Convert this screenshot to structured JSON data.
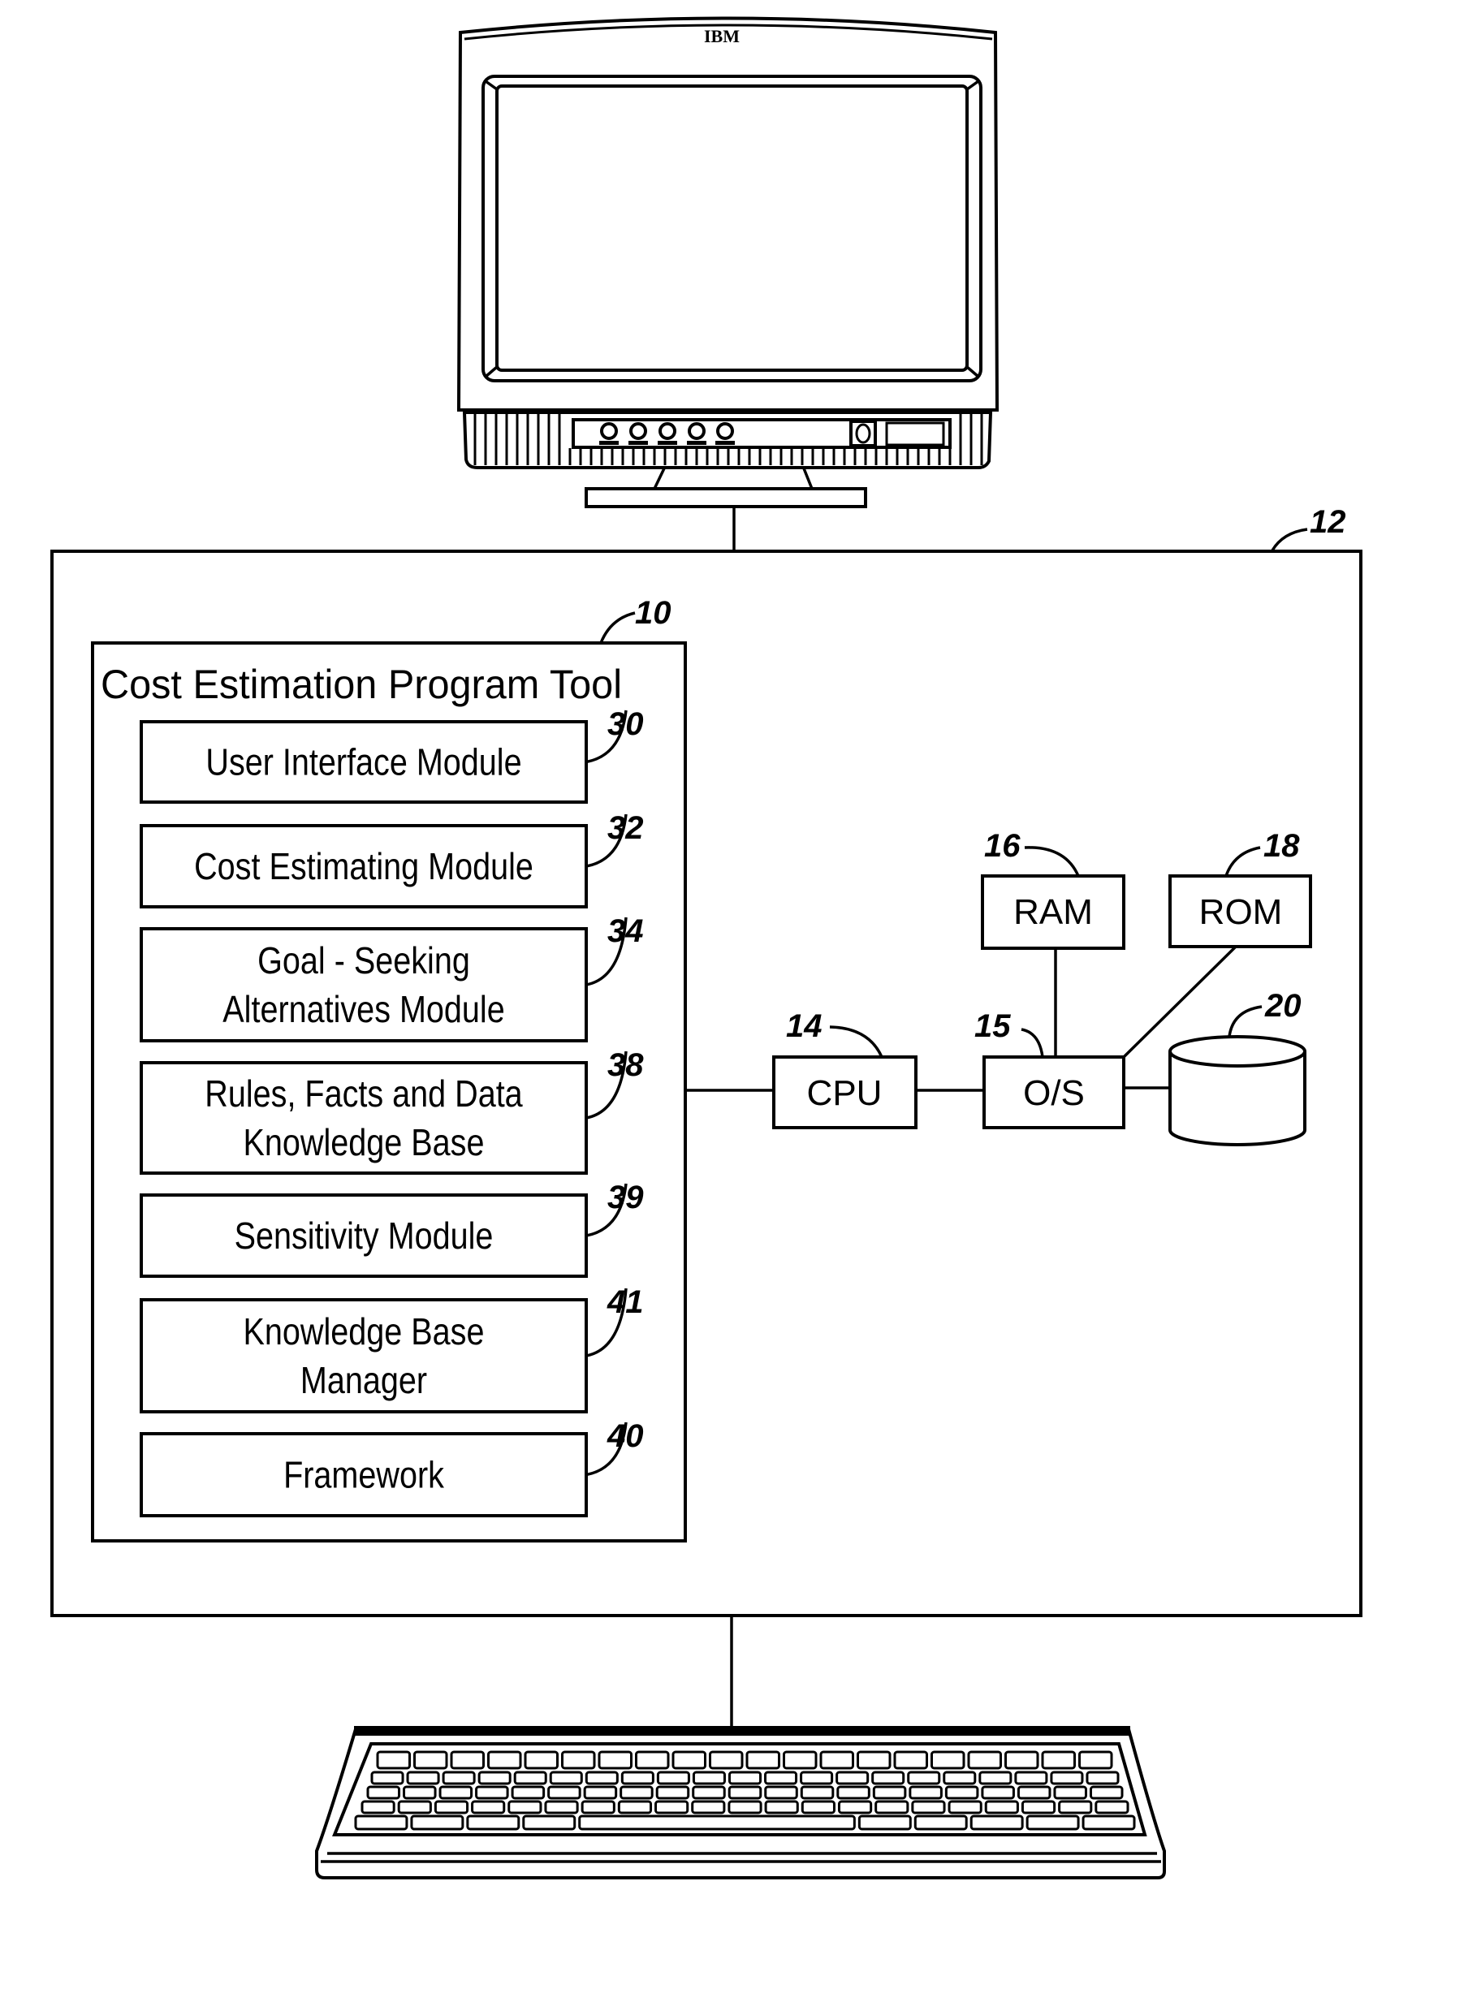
{
  "figure": {
    "monitor": {
      "brand": "IBM"
    },
    "computer": {
      "ref": "12"
    },
    "tool": {
      "ref": "10",
      "title": "Cost Estimation Program Tool",
      "modules": [
        {
          "ref": "30",
          "lines": [
            "User Interface Module"
          ]
        },
        {
          "ref": "32",
          "lines": [
            "Cost Estimating Module"
          ]
        },
        {
          "ref": "34",
          "lines": [
            "Goal - Seeking",
            "Alternatives Module"
          ]
        },
        {
          "ref": "38",
          "lines": [
            "Rules, Facts and Data",
            "Knowledge Base"
          ]
        },
        {
          "ref": "39",
          "lines": [
            "Sensitivity Module"
          ]
        },
        {
          "ref": "41",
          "lines": [
            "Knowledge Base",
            "Manager"
          ]
        },
        {
          "ref": "40",
          "lines": [
            "Framework"
          ]
        }
      ]
    },
    "hardware": {
      "cpu": {
        "label": "CPU",
        "ref": "14"
      },
      "os": {
        "label": "O/S",
        "ref": "15"
      },
      "ram": {
        "label": "RAM",
        "ref": "16"
      },
      "rom": {
        "label": "ROM",
        "ref": "18"
      },
      "storage": {
        "ref": "20"
      }
    },
    "keyboard": {}
  }
}
